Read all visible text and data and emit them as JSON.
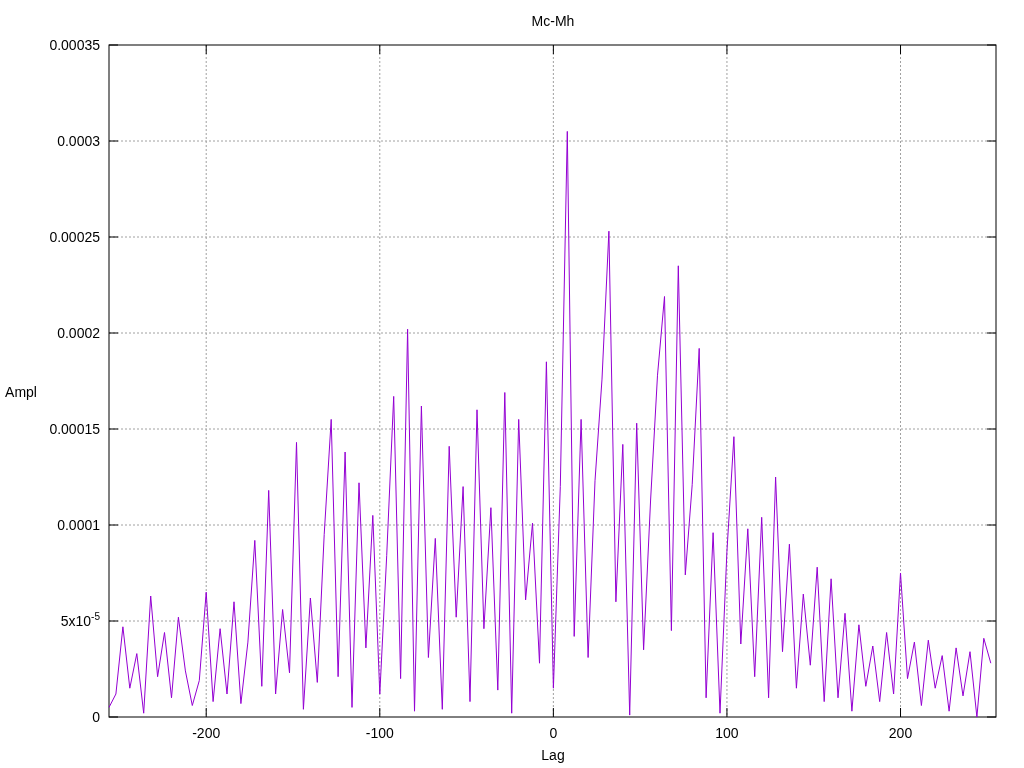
{
  "chart_data": {
    "type": "line",
    "grid": true,
    "title": "Mc-Mh",
    "xlabel": "Lag",
    "ylabel": "Ampl",
    "xlim": [
      -256,
      255
    ],
    "ylim": [
      0,
      0.00035
    ],
    "xticks": [
      -200,
      -100,
      0,
      100,
      200
    ],
    "yticks": [
      {
        "value": 0,
        "label": "0"
      },
      {
        "value": 5e-05,
        "label": "5x10$^{-5}$"
      },
      {
        "value": 0.0001,
        "label": "0.0001"
      },
      {
        "value": 0.00015,
        "label": "0.00015"
      },
      {
        "value": 0.0002,
        "label": "0.0002"
      },
      {
        "value": 0.00025,
        "label": "0.00025"
      },
      {
        "value": 0.0003,
        "label": "0.0003"
      },
      {
        "value": 0.00035,
        "label": "0.00035"
      }
    ],
    "x": [
      -256,
      -252,
      -248,
      -244,
      -240,
      -236,
      -232,
      -228,
      -224,
      -220,
      -216,
      -212,
      -208,
      -204,
      -200,
      -196,
      -192,
      -188,
      -184,
      -180,
      -176,
      -172,
      -168,
      -164,
      -160,
      -156,
      -152,
      -148,
      -144,
      -140,
      -136,
      -132,
      -128,
      -124,
      -120,
      -116,
      -112,
      -108,
      -104,
      -100,
      -96,
      -92,
      -88,
      -84,
      -80,
      -76,
      -72,
      -68,
      -64,
      -60,
      -56,
      -52,
      -48,
      -44,
      -40,
      -36,
      -32,
      -28,
      -24,
      -20,
      -16,
      -12,
      -8,
      -4,
      0,
      4,
      8,
      12,
      16,
      20,
      24,
      28,
      32,
      36,
      40,
      44,
      48,
      52,
      56,
      60,
      64,
      68,
      72,
      76,
      80,
      84,
      88,
      92,
      96,
      100,
      104,
      108,
      112,
      116,
      120,
      124,
      128,
      132,
      136,
      140,
      144,
      148,
      152,
      156,
      160,
      164,
      168,
      172,
      176,
      180,
      184,
      188,
      192,
      196,
      200,
      204,
      208,
      212,
      216,
      220,
      224,
      228,
      232,
      236,
      240,
      244,
      248,
      252
    ],
    "series": [
      {
        "color": "#9400d3",
        "values": [
          5e-06,
          1.2e-05,
          4.7e-05,
          1.5e-05,
          3.3e-05,
          2e-06,
          6.3e-05,
          2.1e-05,
          4.4e-05,
          1e-05,
          5.2e-05,
          2.4e-05,
          6e-06,
          1.9e-05,
          6.5e-05,
          8e-06,
          4.6e-05,
          1.2e-05,
          6e-05,
          7e-06,
          3.9e-05,
          9.2e-05,
          1.6e-05,
          0.000118,
          1.2e-05,
          5.6e-05,
          2.3e-05,
          0.000143,
          4e-06,
          6.2e-05,
          1.8e-05,
          9.5e-05,
          0.000155,
          2.1e-05,
          0.000138,
          5e-06,
          0.000122,
          3.6e-05,
          0.000105,
          1.2e-05,
          8.4e-05,
          0.000167,
          2e-05,
          0.000202,
          3e-06,
          0.000162,
          3.1e-05,
          9.3e-05,
          4e-06,
          0.000141,
          5.2e-05,
          0.00012,
          8e-06,
          0.00016,
          4.6e-05,
          0.000109,
          1.4e-05,
          0.000169,
          2e-06,
          0.000155,
          6.1e-05,
          0.000101,
          2.8e-05,
          0.000185,
          1.5e-05,
          0.00012,
          0.000305,
          4.2e-05,
          0.000155,
          3.1e-05,
          0.000123,
          0.000176,
          0.000253,
          6e-05,
          0.000142,
          1e-06,
          0.000153,
          3.5e-05,
          0.000113,
          0.000178,
          0.000219,
          4.5e-05,
          0.000235,
          7.4e-05,
          0.000121,
          0.000192,
          1e-05,
          9.6e-05,
          2e-06,
          8.6e-05,
          0.000146,
          3.8e-05,
          9.8e-05,
          2.1e-05,
          0.000104,
          1e-05,
          0.000125,
          3.4e-05,
          9e-05,
          1.5e-05,
          6.4e-05,
          2.7e-05,
          7.8e-05,
          8e-06,
          7.2e-05,
          1e-05,
          5.4e-05,
          3e-06,
          4.8e-05,
          1.6e-05,
          3.7e-05,
          8e-06,
          4.4e-05,
          1.2e-05,
          7.5e-05,
          2e-05,
          3.9e-05,
          6e-06,
          4e-05,
          1.5e-05,
          3.2e-05,
          3e-06,
          3.6e-05,
          1.1e-05,
          3.4e-05,
          0.0,
          4.1e-05,
          2.8e-05
        ]
      }
    ]
  }
}
